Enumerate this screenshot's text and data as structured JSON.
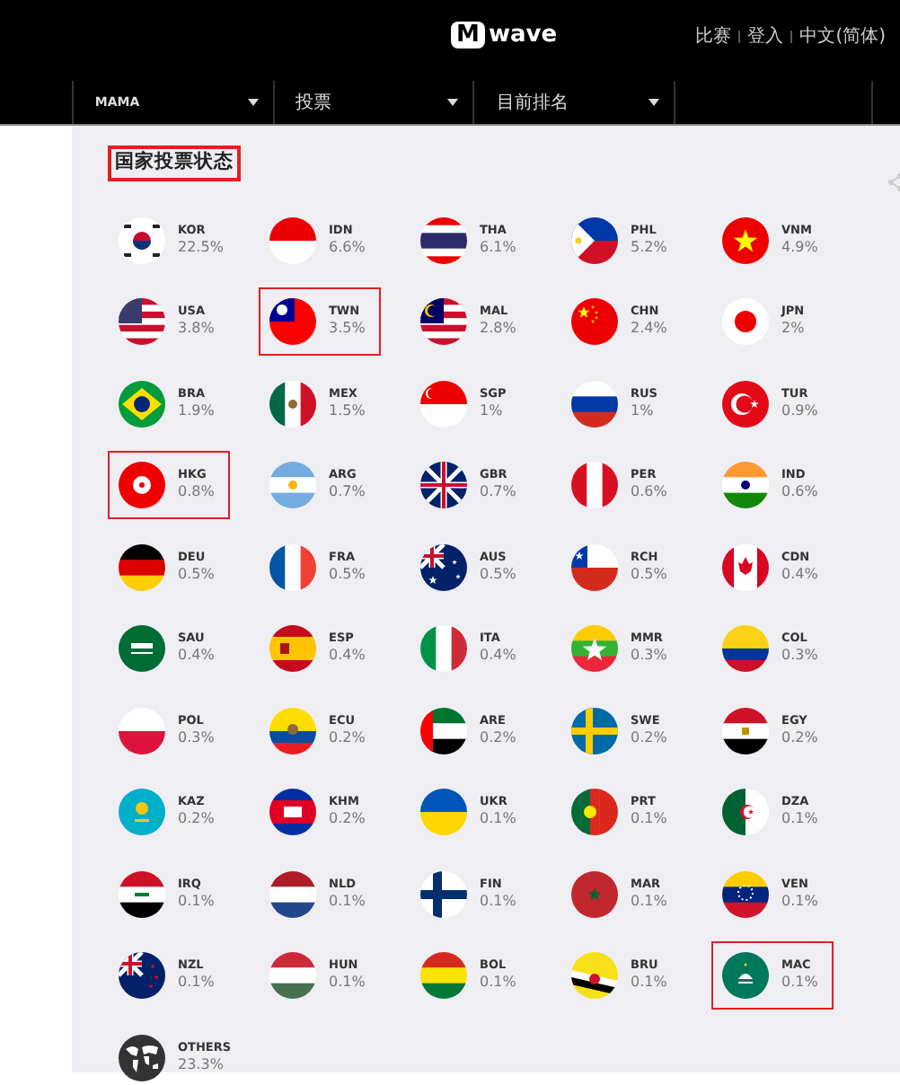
{
  "header": {
    "logo": {
      "mark": "M",
      "text": "wave"
    },
    "links": [
      "比赛",
      "登入",
      "中文(简体)"
    ]
  },
  "nav": {
    "dropdowns": [
      "MAMA",
      "投票",
      "目前排名"
    ]
  },
  "section": {
    "title": "国家投票状态"
  },
  "countries": [
    {
      "code": "KOR",
      "share": "22.5%",
      "highlighted": false
    },
    {
      "code": "IDN",
      "share": "6.6%",
      "highlighted": false
    },
    {
      "code": "THA",
      "share": "6.1%",
      "highlighted": false
    },
    {
      "code": "PHL",
      "share": "5.2%",
      "highlighted": false
    },
    {
      "code": "VNM",
      "share": "4.9%",
      "highlighted": false
    },
    {
      "code": "USA",
      "share": "3.8%",
      "highlighted": false
    },
    {
      "code": "TWN",
      "share": "3.5%",
      "highlighted": true
    },
    {
      "code": "MAL",
      "share": "2.8%",
      "highlighted": false
    },
    {
      "code": "CHN",
      "share": "2.4%",
      "highlighted": false
    },
    {
      "code": "JPN",
      "share": "2%",
      "highlighted": false
    },
    {
      "code": "BRA",
      "share": "1.9%",
      "highlighted": false
    },
    {
      "code": "MEX",
      "share": "1.5%",
      "highlighted": false
    },
    {
      "code": "SGP",
      "share": "1%",
      "highlighted": false
    },
    {
      "code": "RUS",
      "share": "1%",
      "highlighted": false
    },
    {
      "code": "TUR",
      "share": "0.9%",
      "highlighted": false
    },
    {
      "code": "HKG",
      "share": "0.8%",
      "highlighted": true
    },
    {
      "code": "ARG",
      "share": "0.7%",
      "highlighted": false
    },
    {
      "code": "GBR",
      "share": "0.7%",
      "highlighted": false
    },
    {
      "code": "PER",
      "share": "0.6%",
      "highlighted": false
    },
    {
      "code": "IND",
      "share": "0.6%",
      "highlighted": false
    },
    {
      "code": "DEU",
      "share": "0.5%",
      "highlighted": false
    },
    {
      "code": "FRA",
      "share": "0.5%",
      "highlighted": false
    },
    {
      "code": "AUS",
      "share": "0.5%",
      "highlighted": false
    },
    {
      "code": "RCH",
      "share": "0.5%",
      "highlighted": false
    },
    {
      "code": "CDN",
      "share": "0.4%",
      "highlighted": false
    },
    {
      "code": "SAU",
      "share": "0.4%",
      "highlighted": false
    },
    {
      "code": "ESP",
      "share": "0.4%",
      "highlighted": false
    },
    {
      "code": "ITA",
      "share": "0.4%",
      "highlighted": false
    },
    {
      "code": "MMR",
      "share": "0.3%",
      "highlighted": false
    },
    {
      "code": "COL",
      "share": "0.3%",
      "highlighted": false
    },
    {
      "code": "POL",
      "share": "0.3%",
      "highlighted": false
    },
    {
      "code": "ECU",
      "share": "0.2%",
      "highlighted": false
    },
    {
      "code": "ARE",
      "share": "0.2%",
      "highlighted": false
    },
    {
      "code": "SWE",
      "share": "0.2%",
      "highlighted": false
    },
    {
      "code": "EGY",
      "share": "0.2%",
      "highlighted": false
    },
    {
      "code": "KAZ",
      "share": "0.2%",
      "highlighted": false
    },
    {
      "code": "KHM",
      "share": "0.2%",
      "highlighted": false
    },
    {
      "code": "UKR",
      "share": "0.1%",
      "highlighted": false
    },
    {
      "code": "PRT",
      "share": "0.1%",
      "highlighted": false
    },
    {
      "code": "DZA",
      "share": "0.1%",
      "highlighted": false
    },
    {
      "code": "IRQ",
      "share": "0.1%",
      "highlighted": false
    },
    {
      "code": "NLD",
      "share": "0.1%",
      "highlighted": false
    },
    {
      "code": "FIN",
      "share": "0.1%",
      "highlighted": false
    },
    {
      "code": "MAR",
      "share": "0.1%",
      "highlighted": false
    },
    {
      "code": "VEN",
      "share": "0.1%",
      "highlighted": false
    },
    {
      "code": "NZL",
      "share": "0.1%",
      "highlighted": false
    },
    {
      "code": "HUN",
      "share": "0.1%",
      "highlighted": false
    },
    {
      "code": "BOL",
      "share": "0.1%",
      "highlighted": false
    },
    {
      "code": "BRU",
      "share": "0.1%",
      "highlighted": false
    },
    {
      "code": "MAC",
      "share": "0.1%",
      "highlighted": true
    },
    {
      "code": "OTHERS",
      "share": "23.3%",
      "highlighted": false
    }
  ]
}
